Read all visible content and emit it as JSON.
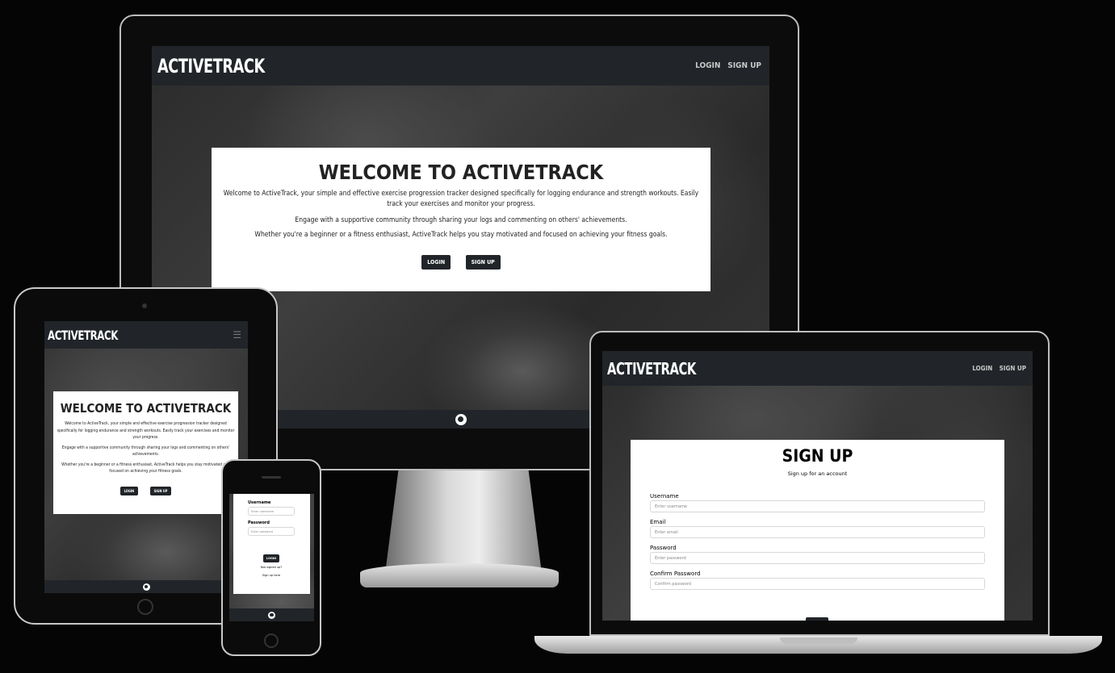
{
  "brand": "ACTIVETRACK",
  "nav": {
    "login": "LOGIN",
    "signup": "SIGN UP"
  },
  "welcome": {
    "title": "WELCOME TO ACTIVETRACK",
    "p1_desktop": "Welcome to ActiveTrack, your simple and effective exercise progression tracker designed specifically for logging endurance and strength workouts. Easily track your exercises and monitor your progress.",
    "p2": "Engage with a supportive community through sharing your logs and commenting on others' achievements.",
    "p3": "Whether you're a beginner or a fitness enthusiast, ActiveTrack helps you stay motivated and focused on achieving your fitness goals.",
    "login_btn": "LOGIN",
    "signup_btn": "SIGN UP"
  },
  "phone_login": {
    "username_label": "Username",
    "username_placeholder": "Enter username",
    "password_label": "Password",
    "password_placeholder": "Enter password",
    "login_btn": "LOGIN",
    "not_signed_up": "Not signed up?",
    "sign_up_here": "Sign up here"
  },
  "signup_form": {
    "title": "SIGN UP",
    "subtitle": "Sign up for an account",
    "username_label": "Username",
    "username_placeholder": "Enter username",
    "email_label": "Email",
    "email_placeholder": "Enter email",
    "password_label": "Password",
    "password_placeholder": "Enter password",
    "confirm_label": "Confirm Password",
    "confirm_placeholder": "Confirm password"
  },
  "icons": {
    "footer": "github-icon",
    "menu": "hamburger-menu-icon"
  }
}
